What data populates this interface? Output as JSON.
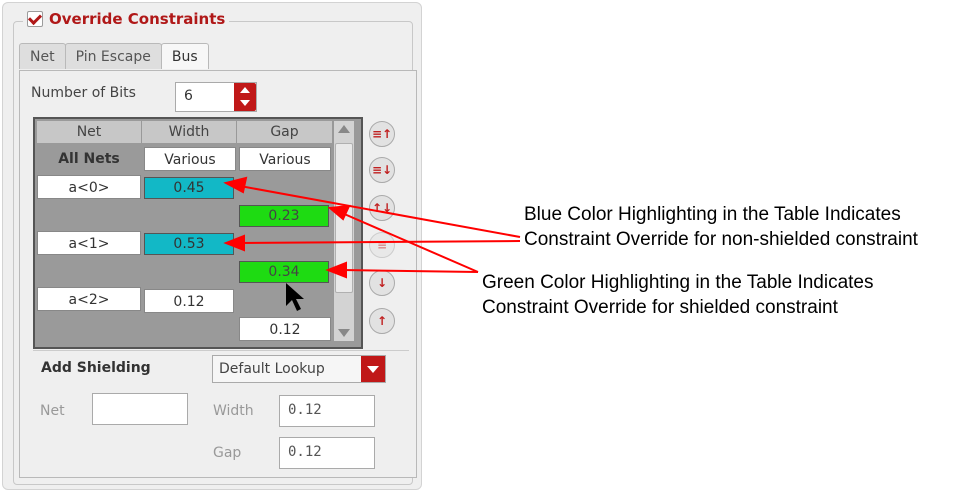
{
  "override": {
    "label": "Override Constraints",
    "checked": true
  },
  "tabs": [
    "Net",
    "Pin Escape",
    "Bus"
  ],
  "active_tab": "Bus",
  "bits": {
    "label": "Number of Bits",
    "value": "6"
  },
  "table": {
    "headers": [
      "Net",
      "Width",
      "Gap"
    ],
    "all_nets": {
      "label": "All Nets",
      "width": "Various",
      "gap": "Various"
    },
    "rows": [
      {
        "net": "a<0>",
        "width": "0.45",
        "gap": ""
      },
      {
        "net": "",
        "width": "",
        "gap": "0.23"
      },
      {
        "net": "a<1>",
        "width": "0.53",
        "gap": ""
      },
      {
        "net": "",
        "width": "",
        "gap": "0.34"
      },
      {
        "net": "a<2>",
        "width": "0.12",
        "gap": ""
      },
      {
        "net": "",
        "width": "",
        "gap": "0.12"
      }
    ]
  },
  "side_buttons": [
    "move-to-top-icon",
    "move-down-icon",
    "swap-icon",
    "remove-icon",
    "add-shield-down-icon",
    "add-shield-up-icon"
  ],
  "shielding": {
    "title": "Add Shielding",
    "lookup": "Default Lookup",
    "net_label": "Net",
    "net_value": "",
    "width_label": "Width",
    "width_value": "0.12",
    "gap_label": "Gap",
    "gap_value": "0.12"
  },
  "annotations": {
    "blue_line1": "Blue Color Highlighting in the Table Indicates",
    "blue_line2": "Constraint Override for non-shielded constraint",
    "green_line1": "Green Color Highlighting in the Table Indicates",
    "green_line2": "Constraint Override for shielded constraint"
  },
  "colors": {
    "accent": "#c01818",
    "cyan": "#12b8c6",
    "green": "#1edb12",
    "arrow": "#ff0000"
  }
}
